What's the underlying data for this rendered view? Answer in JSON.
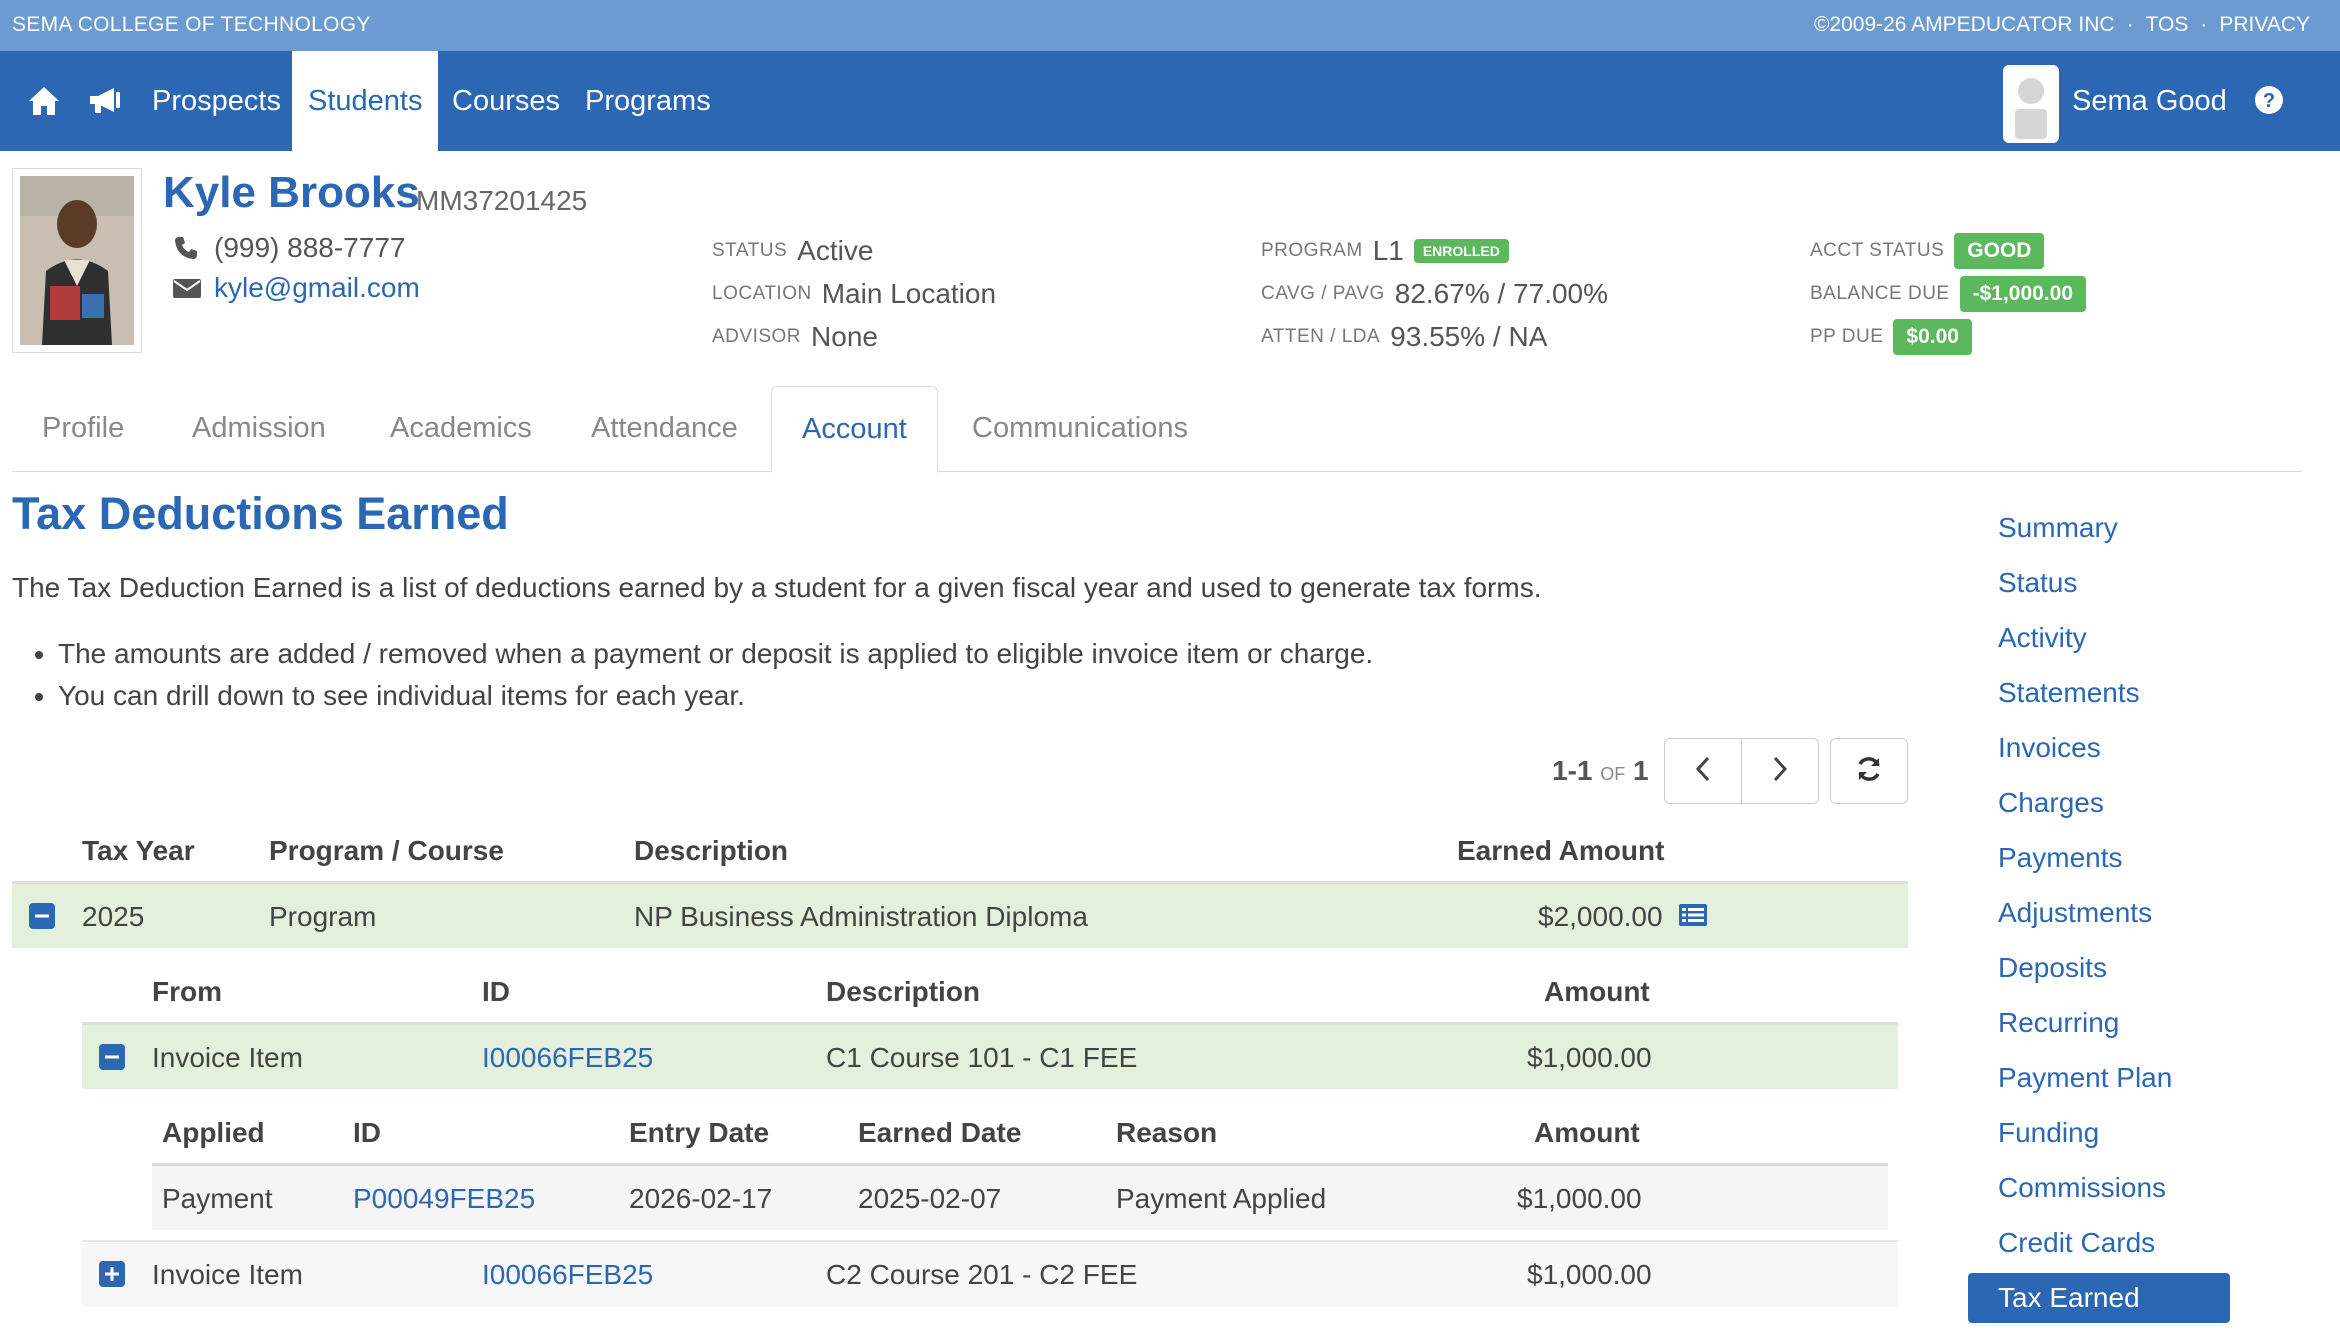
{
  "topbar": {
    "school": "SEMA COLLEGE OF TECHNOLOGY",
    "copyright": "©2009-26 AMPEDUCATOR INC",
    "tos": "TOS",
    "privacy": "PRIVACY",
    "separator": "·"
  },
  "nav": {
    "icons": [
      "home-icon",
      "megaphone-icon"
    ],
    "links": [
      "Prospects",
      "Students",
      "Courses",
      "Programs"
    ],
    "active": "Students",
    "user_name": "Sema Good",
    "colors": {
      "bar": "#2b67b3",
      "strip": "#6b9bd0"
    }
  },
  "student": {
    "name": "Kyle Brooks",
    "id": "MM37201425",
    "phone": "(999) 888-7777",
    "email": "kyle@gmail.com",
    "status_label": "STATUS",
    "status": "Active",
    "location_label": "LOCATION",
    "location": "Main Location",
    "advisor_label": "ADVISOR",
    "advisor": "None",
    "program_label": "PROGRAM",
    "program": "L1",
    "program_badge": "ENROLLED",
    "cavg_label": "CAVG / PAVG",
    "cavg": "82.67% / 77.00%",
    "atten_label": "ATTEN / LDA",
    "atten": "93.55% / NA",
    "acct_status_label": "ACCT STATUS",
    "acct_status": "GOOD",
    "balance_due_label": "BALANCE DUE",
    "balance_due": "-$1,000.00",
    "pp_due_label": "PP DUE",
    "pp_due": "$0.00",
    "badge_color": "#5cb85c"
  },
  "tabs": {
    "items": [
      "Profile",
      "Admission",
      "Academics",
      "Attendance",
      "Account",
      "Communications"
    ],
    "active": "Account"
  },
  "main": {
    "title": "Tax Deductions Earned",
    "intro": "The Tax Deduction Earned is a list of deductions earned by a student for a given fiscal year and used to generate tax forms.",
    "bullets": [
      "The amounts are added / removed when a payment or deposit is applied to eligible invoice item or charge.",
      "You can drill down to see individual items for each year."
    ],
    "pager": {
      "range": "1-1",
      "of": "OF",
      "total": "1"
    },
    "table": {
      "headers": [
        "Tax Year",
        "Program / Course",
        "Description",
        "Earned Amount"
      ],
      "rows": [
        {
          "year": "2025",
          "type": "Program",
          "description": "NP Business Administration Diploma",
          "amount": "$2,000.00"
        }
      ]
    },
    "subtable": {
      "headers": [
        "From",
        "ID",
        "Description",
        "Amount"
      ],
      "rows": [
        {
          "from": "Invoice Item",
          "id": "I00066FEB25",
          "description": "C1 Course 101 - C1 FEE",
          "amount": "$1,000.00"
        },
        {
          "from": "Invoice Item",
          "id": "I00066FEB25",
          "description": "C2 Course 201 - C2 FEE",
          "amount": "$1,000.00"
        }
      ]
    },
    "detailtable": {
      "headers": [
        "Applied",
        "ID",
        "Entry Date",
        "Earned Date",
        "Reason",
        "Amount"
      ],
      "rows": [
        {
          "applied": "Payment",
          "id": "P00049FEB25",
          "entry_date": "2026-02-17",
          "earned_date": "2025-02-07",
          "reason": "Payment Applied",
          "amount": "$1,000.00"
        }
      ]
    },
    "row_highlight_color": "#e3f0dc"
  },
  "sidebar": {
    "items": [
      "Summary",
      "Status",
      "Activity",
      "Statements",
      "Invoices",
      "Charges",
      "Payments",
      "Adjustments",
      "Deposits",
      "Recurring",
      "Payment Plan",
      "Funding",
      "Commissions",
      "Credit Cards",
      "Tax Earned"
    ],
    "active": "Tax Earned"
  }
}
